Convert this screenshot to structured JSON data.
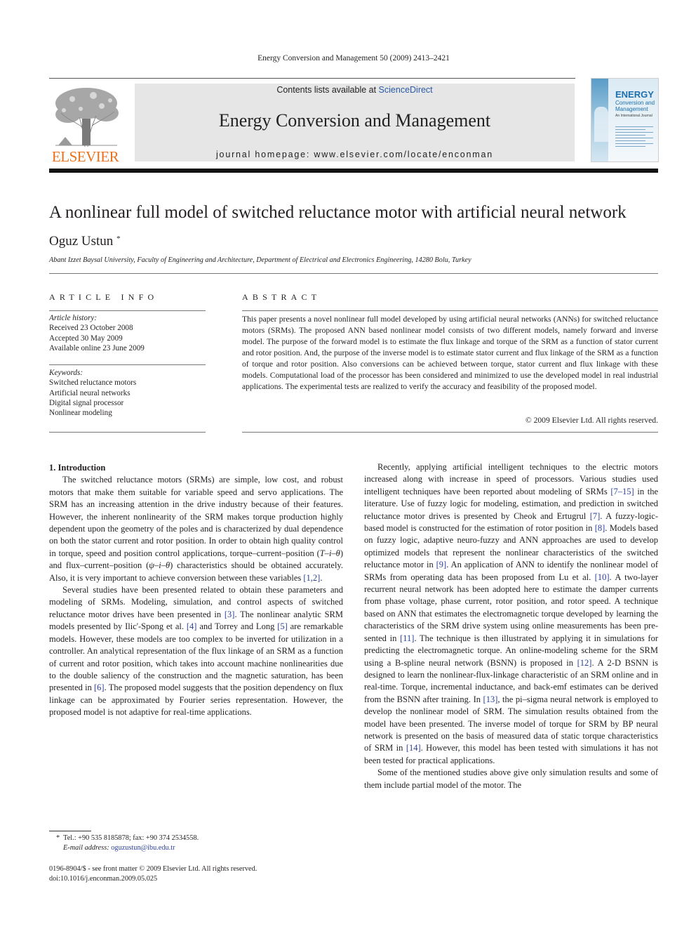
{
  "running_head": "Energy Conversion and Management 50 (2009) 2413–2421",
  "header": {
    "publisher_logo_text": "ELSEVIER",
    "contents_prefix": "Contents lists available at ",
    "contents_link": "ScienceDirect",
    "journal_title": "Energy Conversion and Management",
    "homepage": "journal homepage: www.elsevier.com/locate/enconman",
    "cover": {
      "title": "ENERGY",
      "subtitle_1": "Conversion and",
      "subtitle_2": "Management",
      "tagline": "An International Journal"
    }
  },
  "article": {
    "title": "A nonlinear full model of switched reluctance motor with artificial neural network",
    "author": "Oguz Ustun",
    "author_mark": "*",
    "affiliation": "Abant Izzet Baysal University, Faculty of Engineering and Architecture, Department of Electrical and Electronics Engineering, 14280 Bolu, Turkey"
  },
  "article_info": {
    "heading": "ARTICLE INFO",
    "history_label": "Article history:",
    "history": [
      "Received 23 October 2008",
      "Accepted 30 May 2009",
      "Available online 23 June 2009"
    ],
    "keywords_label": "Keywords:",
    "keywords": [
      "Switched reluctance motors",
      "Artificial neural networks",
      "Digital signal processor",
      "Nonlinear modeling"
    ]
  },
  "abstract": {
    "heading": "ABSTRACT",
    "text": "This paper presents a novel nonlinear full model developed by using artificial neural networks (ANNs) for switched reluctance motors (SRMs). The proposed ANN based nonlinear model consists of two different models, namely forward and inverse model. The purpose of the forward model is to estimate the flux linkage and torque of the SRM as a function of stator current and rotor position. And, the purpose of the inverse model is to estimate stator current and flux linkage of the SRM as a function of torque and rotor position. Also conversions can be achieved between torque, stator current and flux linkage with these models. Computational load of the processor has been considered and minimized to use the devel­oped model in real industrial applications. The experimental tests are realized to verify the accuracy and feasibility of the proposed model.",
    "copyright": "© 2009 Elsevier Ltd. All rights reserved."
  },
  "body": {
    "section_heading": "1. Introduction",
    "left_paragraphs": [
      [
        {
          "t": "The switched reluctance motors (SRMs) are simple, low cost, and robust motors that make them suitable for variable speed and servo applications. The SRM has an increasing attention in the drive industry because of their features. However, the inherent nonlinearity of the SRM makes torque production highly depen­dent upon the geometry of the poles and is characterized by dual dependence on both the stator current and rotor position. In order to obtain high quality control in torque, speed and position control applications, torque–current–position ("
        },
        {
          "t": "T–i–θ",
          "i": true
        },
        {
          "t": ") and flux–current–position ("
        },
        {
          "t": "ψ–i–θ",
          "i": true
        },
        {
          "t": ") characteristics should be obtained accurately. Also, it is very important to achieve conversion between these vari­ables "
        },
        {
          "t": "[1,2]",
          "r": true
        },
        {
          "t": "."
        }
      ],
      [
        {
          "t": "Several studies have been presented related to obtain these parameters and modeling of SRMs. Modeling, simulation, and con­trol aspects of switched reluctance motor drives have been pre­sented in "
        },
        {
          "t": "[3]",
          "r": true
        },
        {
          "t": ". The nonlinear analytic SRM models presented by Ilic'-Spong et al. "
        },
        {
          "t": "[4]",
          "r": true
        },
        {
          "t": " and Torrey and Long "
        },
        {
          "t": "[5]",
          "r": true
        },
        {
          "t": " are remarkable mod­els. However, these models are too complex to be inverted for uti­lization in a controller. An analytical representation of the flux linkage of an SRM as a function of current and rotor position, which takes into account machine nonlinearities due to the double sal­iency of the construction and the magnetic saturation, has been presented in "
        },
        {
          "t": "[6]",
          "r": true
        },
        {
          "t": ". The proposed model suggests that the position dependency on flux linkage can be approximated by Fourier series representation. However, the proposed model is not adaptive for real-time applications."
        }
      ]
    ],
    "right_paragraphs": [
      [
        {
          "t": "Recently, applying artificial intelligent techniques to the electric motors increased along with increase in speed of processors. Vari­ous studies used intelligent techniques have been reported about modeling of SRMs "
        },
        {
          "t": "[7–15]",
          "r": true
        },
        {
          "t": " in the literature. Use of fuzzy logic for modeling, estimation, and prediction in switched reluctance motor drives is presented by Cheok and Ertugrul "
        },
        {
          "t": "[7]",
          "r": true
        },
        {
          "t": ". A fuzzy-logic-based model is constructed for the estimation of rotor position in "
        },
        {
          "t": "[8]",
          "r": true
        },
        {
          "t": ". Models based on fuzzy logic, adaptive neuro-fuzzy and ANN ap­proaches are used to develop optimized models that represent the nonlinear characteristics of the switched reluctance motor in "
        },
        {
          "t": "[9]",
          "r": true
        },
        {
          "t": ". An application of ANN to identify the nonlinear model of SRMs from operating data has been proposed from Lu et al. "
        },
        {
          "t": "[10]",
          "r": true
        },
        {
          "t": ". A two-layer recurrent neural network has been adopted here to estimate the damper currents from phase voltage, phase current, rotor posi­tion, and rotor speed. A technique based on ANN that estimates the electromagnetic torque developed by learning the characteristics of the SRM drive system using online measurements has been pre­sented in "
        },
        {
          "t": "[11]",
          "r": true
        },
        {
          "t": ". The technique is then illustrated by applying it in simulations for predicting the electromagnetic torque. An online-modeling scheme for the SRM using a B-spline neural network (BSNN) is proposed in "
        },
        {
          "t": "[12]",
          "r": true
        },
        {
          "t": ". A 2-D BSNN is designed to learn the nonlinear-flux-linkage characteristic of an SRM online and in real-time. Torque, incremental inductance, and back-emf estimates can be derived from the BSNN after training. In "
        },
        {
          "t": "[13]",
          "r": true
        },
        {
          "t": ", the pi–sigma neural network is employed to develop the nonlinear model of SRM. The simulation results obtained from the model have been presented. The inverse model of torque for SRM by BP neural net­work is presented on the basis of measured data of static torque characteristics of SRM in "
        },
        {
          "t": "[14]",
          "r": true
        },
        {
          "t": ". However, this model has been tested with simulations it has not been tested for practical applications."
        }
      ],
      [
        {
          "t": "Some of the mentioned studies above give only simulation re­sults and some of them include partial model of the motor. The"
        }
      ]
    ]
  },
  "footnote": {
    "mark": "*",
    "contact": "Tel.: +90 535 8185878; fax: +90 374 2534558.",
    "email_label": "E-mail address:",
    "email": "oguzustun@ibu.edu.tr"
  },
  "front_matter": {
    "issn": "0196-8904/$ - see front matter © 2009 Elsevier Ltd. All rights reserved.",
    "doi": "doi:10.1016/j.enconman.2009.05.025"
  },
  "colors": {
    "elsevier_orange": "#e9711c",
    "link_blue": "#2a3f9a",
    "sciencedirect_blue": "#2a5aa7",
    "banner_gray": "#e6e6e6"
  }
}
